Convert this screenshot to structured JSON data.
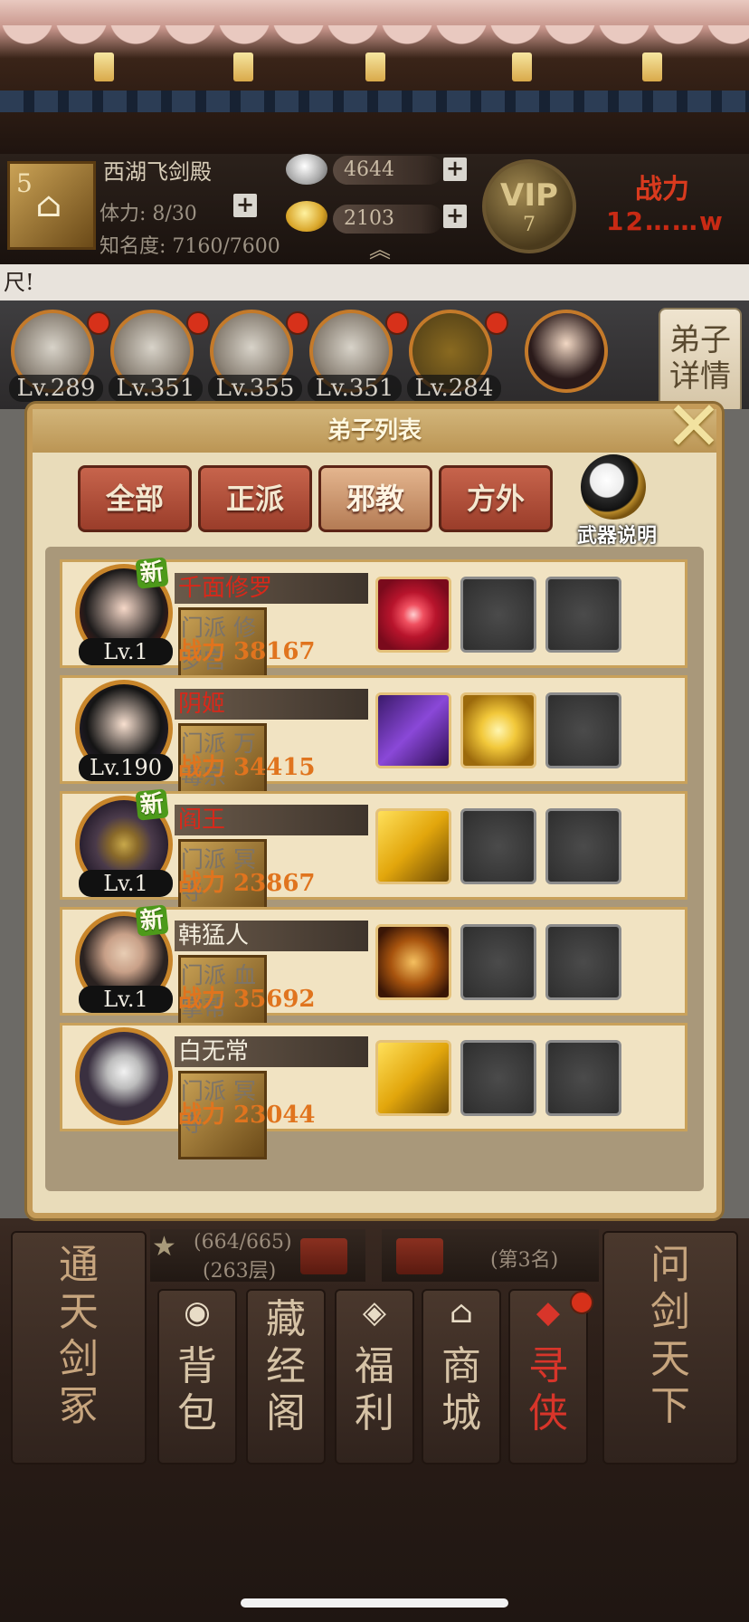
{
  "header": {
    "sect_level": "5",
    "sect_name": "西湖飞剑殿",
    "stamina_label": "体力: 8/30",
    "fame_label": "知名度: 7160/7600",
    "silver": "4644",
    "gold": "2103",
    "vip_label": "VIP",
    "vip_level": "7",
    "power_label": "战力",
    "power_value": "12……w"
  },
  "notice": {
    "text": "尺!"
  },
  "hero_strip": {
    "levels": [
      "Lv.289",
      "Lv.351",
      "Lv.355",
      "Lv.351",
      "Lv.284"
    ],
    "detail_tab": "弟子\n详情"
  },
  "modal": {
    "title": "弟子列表",
    "tabs": [
      {
        "label": "全部",
        "active": false
      },
      {
        "label": "正派",
        "active": false
      },
      {
        "label": "邪教",
        "active": true
      },
      {
        "label": "方外",
        "active": false
      }
    ],
    "weapon_info_label": "武器说明",
    "disciples": [
      {
        "name": "千面修罗",
        "name_color": "#d8281a",
        "level": "Lv.1",
        "is_new": true,
        "new_label": "新",
        "sect": "门派  修罗宫",
        "power": "战力 38167",
        "weapons": [
          "red-vortex-icon"
        ]
      },
      {
        "name": "阴姬",
        "name_color": "#d8281a",
        "level": "Lv.190",
        "is_new": false,
        "new_label": "",
        "sect": "门派  万毒宗",
        "power": "战力 34415",
        "weapons": [
          "purple-blade-icon",
          "golden-whip-icon"
        ]
      },
      {
        "name": "阎王",
        "name_color": "#d8281a",
        "level": "Lv.1",
        "is_new": true,
        "new_label": "新",
        "sect": "门派  冥寺",
        "power": "战力 23867",
        "weapons": [
          "silhouette-icon"
        ]
      },
      {
        "name": "韩猛人",
        "name_color": "#f2ecdc",
        "level": "Lv.1",
        "is_new": true,
        "new_label": "新",
        "sect": "门派  血掌帮",
        "power": "战力 35692",
        "weapons": [
          "fire-palm-icon"
        ]
      },
      {
        "name": "白无常",
        "name_color": "#f2ecdc",
        "level": "",
        "is_new": false,
        "new_label": "",
        "sect": "门派  冥寺",
        "power": "战力 23044",
        "weapons": [
          "silhouette-icon"
        ]
      }
    ]
  },
  "bottom": {
    "left_panel": "通天剑冢",
    "right_panel": "问剑天下",
    "tower_progress": "(664/665)",
    "tower_floor": "(263层)",
    "rank": "(第3名)",
    "buttons": [
      {
        "label": "背包",
        "icon": "bag-icon"
      },
      {
        "label": "藏经阁",
        "icon": "pavilion-icon"
      },
      {
        "label": "福利",
        "icon": "gift-icon"
      },
      {
        "label": "商城",
        "icon": "shop-icon"
      },
      {
        "label": "寻侠",
        "icon": "seek-icon"
      }
    ]
  }
}
